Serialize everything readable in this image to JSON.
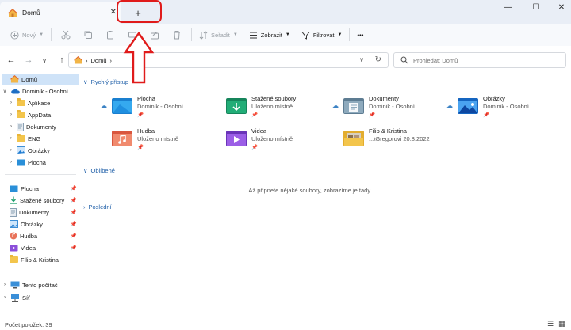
{
  "tab": {
    "title": "Domů",
    "close_glyph": "✕"
  },
  "new_tab_glyph": "+",
  "window_controls": {
    "minimize": "—",
    "maximize": "☐",
    "close": "✕"
  },
  "toolbar": {
    "new_label": "Nový",
    "sort_label": "Seřadit",
    "view_label": "Zobrazit",
    "filter_label": "Filtrovat",
    "more_label": "•••"
  },
  "address": {
    "segment": "Domů"
  },
  "search": {
    "placeholder": "Prohledat: Domů"
  },
  "sidebar": {
    "home": "Domů",
    "onedrive": "Dominik - Osobní",
    "tree": [
      "Aplikace",
      "AppData",
      "Dokumenty",
      "ENG",
      "Obrázky",
      "Plocha"
    ],
    "pinned": [
      "Plocha",
      "Stažené soubory",
      "Dokumenty",
      "Obrázky",
      "Hudba",
      "Videa",
      "Filip & Kristina"
    ],
    "this_pc": "Tento počítač",
    "network": "Síť"
  },
  "main": {
    "quick_access": "Rychlý přístup",
    "favorites": "Oblíbené",
    "recent": "Poslední",
    "empty_message": "Až připnete nějaké soubory, zobrazíme je tady.",
    "items": [
      {
        "name": "Plocha",
        "sub": "Dominik - Osobní",
        "icon": "desktop-folder-icon",
        "color": "#2b9de0"
      },
      {
        "name": "Stažené soubory",
        "sub": "Uloženo místně",
        "icon": "downloads-folder-icon",
        "color": "#1e9e6c"
      },
      {
        "name": "Dokumenty",
        "sub": "Dominik - Osobní",
        "icon": "documents-folder-icon",
        "color": "#6f8fa6"
      },
      {
        "name": "Obrázky",
        "sub": "Dominik - Osobní",
        "icon": "pictures-folder-icon",
        "color": "#1e88e5"
      },
      {
        "name": "Hudba",
        "sub": "Uloženo místně",
        "icon": "music-folder-icon",
        "color": "#e8735a"
      },
      {
        "name": "Videa",
        "sub": "Uloženo místně",
        "icon": "videos-folder-icon",
        "color": "#8b4fd9"
      },
      {
        "name": "Filip & Kristina",
        "sub": "...\\Gregorovi 20.8.2022",
        "icon": "photo-folder-icon",
        "color": "#f3c54c"
      }
    ]
  },
  "status": {
    "count": "Počet položek: 39"
  },
  "annotation_color": "#e01b1b"
}
